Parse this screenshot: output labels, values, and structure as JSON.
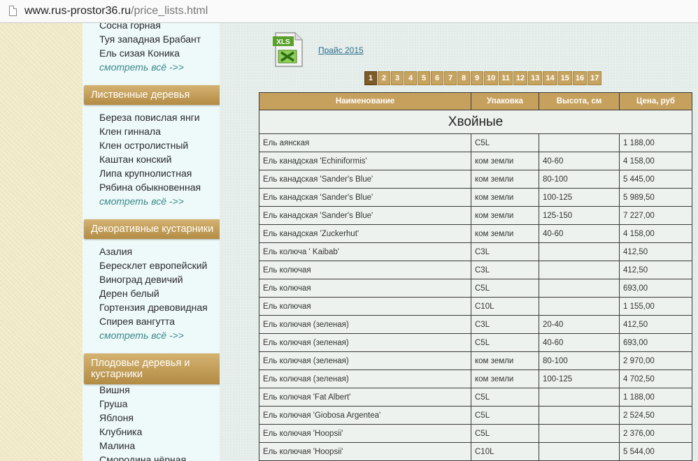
{
  "browser": {
    "url_host": "www.rus-prostor36.ru",
    "url_path": "/price_lists.html"
  },
  "sidebar": {
    "items_top": [
      "Сосна горная",
      "Туя западная Брабант",
      "Ель сизая Коника"
    ],
    "more_link": "смотреть всё ->>",
    "categories": [
      {
        "title": "Лиственные деревья",
        "items": [
          "Береза повислая янги",
          "Клен гиннала",
          "Клен остролистный",
          "Каштан конский",
          "Липа крупнолистная",
          "Рябина обыкновенная"
        ]
      },
      {
        "title": "Декоративные кустарники",
        "items": [
          "Азалия",
          "Бересклет европейский",
          "Виноград девичий",
          "Дерен белый",
          "Гортензия древовидная",
          "Спирея вангутта"
        ]
      },
      {
        "title": "Плодовые деревья и кустарники",
        "items": [
          "Вишня",
          "Груша",
          "Яблоня",
          "Клубника",
          "Малина",
          "Смородина чёрная"
        ]
      }
    ]
  },
  "main": {
    "file_icon_label": "XLS",
    "price_link": "Прайс 2015",
    "pages": [
      "1",
      "2",
      "3",
      "4",
      "5",
      "6",
      "7",
      "8",
      "9",
      "10",
      "11",
      "12",
      "13",
      "14",
      "15",
      "16",
      "17"
    ],
    "active_page": "1",
    "table": {
      "headers": [
        "Наименование",
        "Упаковка",
        "Высота, см",
        "Цена, руб"
      ],
      "section": "Хвойные",
      "rows": [
        [
          "Ель аянская",
          "C5L",
          "",
          "1 188,00"
        ],
        [
          "Ель канадская 'Echiniformis'",
          "ком земли",
          "40-60",
          "4 158,00"
        ],
        [
          "Ель канадская 'Sander's Blue'",
          "ком земли",
          "80-100",
          "5 445,00"
        ],
        [
          "Ель канадская 'Sander's Blue'",
          "ком земли",
          "100-125",
          "5 989,50"
        ],
        [
          "Ель канадская 'Sander's Blue'",
          "ком земли",
          "125-150",
          "7 227,00"
        ],
        [
          "Ель канадская 'Zuckerhut'",
          "ком земли",
          "40-60",
          "4 158,00"
        ],
        [
          "Ель колюча ' Kaibab'",
          "C3L",
          "",
          "412,50"
        ],
        [
          "Ель колючая",
          "C3L",
          "",
          "412,50"
        ],
        [
          "Ель колючая",
          "C5L",
          "",
          "693,00"
        ],
        [
          "Ель колючая",
          "C10L",
          "",
          "1 155,00"
        ],
        [
          "Ель колючая (зеленая)",
          "C3L",
          "20-40",
          "412,50"
        ],
        [
          "Ель колючая (зеленая)",
          "C5L",
          "40-60",
          "693,00"
        ],
        [
          "Ель колючая (зеленая)",
          "ком земли",
          "80-100",
          "2 970,00"
        ],
        [
          "Ель колючая (зеленая)",
          "ком земли",
          "100-125",
          "4 702,50"
        ],
        [
          "Ель колючая 'Fat Albert'",
          "C5L",
          "",
          "1 188,00"
        ],
        [
          "Ель колючая 'Giobosa Argentea'",
          "C5L",
          "",
          "2 524,50"
        ],
        [
          "Ель колючая 'Hoopsii'",
          "C5L",
          "",
          "2 376,00"
        ],
        [
          "Ель колючая 'Hoopsii'",
          "C10L",
          "",
          "5 544,00"
        ]
      ]
    }
  }
}
